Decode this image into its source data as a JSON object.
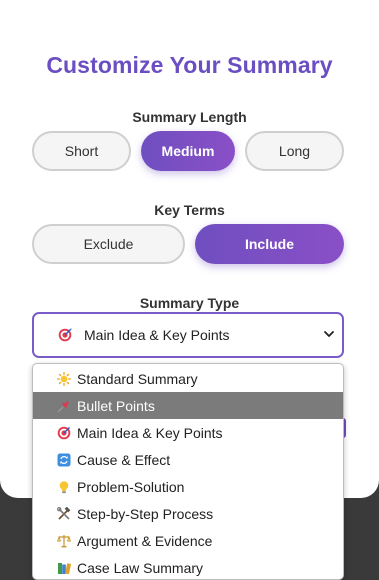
{
  "title": "Customize Your Summary",
  "summary_length": {
    "label": "Summary Length",
    "options": [
      "Short",
      "Medium",
      "Long"
    ],
    "selected": "Medium"
  },
  "key_terms": {
    "label": "Key Terms",
    "options": [
      "Exclude",
      "Include"
    ],
    "selected": "Include"
  },
  "summary_type": {
    "label": "Summary Type",
    "selected_icon": "dart-target-icon",
    "selected": "Main Idea & Key Points",
    "options": [
      {
        "icon": "sun-icon",
        "label": "Standard Summary"
      },
      {
        "icon": "pushpin-icon",
        "label": "Bullet Points"
      },
      {
        "icon": "dart-target-icon",
        "label": "Main Idea & Key Points"
      },
      {
        "icon": "cycle-arrows-icon",
        "label": "Cause & Effect"
      },
      {
        "icon": "lightbulb-icon",
        "label": "Problem-Solution"
      },
      {
        "icon": "hammer-wrench-icon",
        "label": "Step-by-Step Process"
      },
      {
        "icon": "balance-scale-icon",
        "label": "Argument & Evidence"
      },
      {
        "icon": "books-icon",
        "label": "Case Law Summary"
      }
    ],
    "highlighted": "Bullet Points"
  },
  "colors": {
    "accent": "#6b4fc2",
    "highlight_row": "#7b7b7b",
    "backdrop": "#3a3a3a"
  }
}
